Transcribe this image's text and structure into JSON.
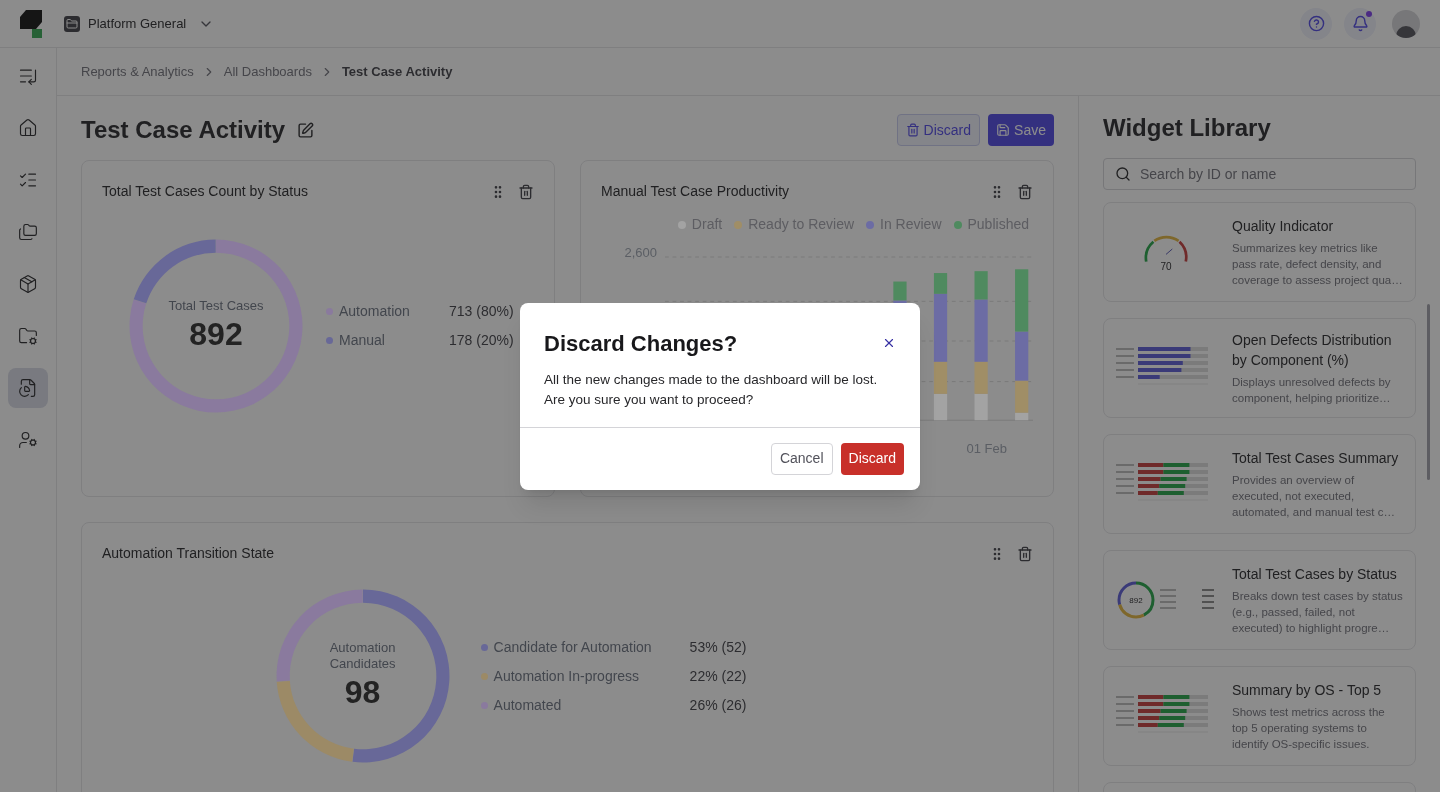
{
  "topbar": {
    "workspace": "Platform General",
    "notification_dot": true
  },
  "breadcrumbs": [
    {
      "label": "Reports & Analytics",
      "current": false
    },
    {
      "label": "All Dashboards",
      "current": false
    },
    {
      "label": "Test Case Activity",
      "current": true
    }
  ],
  "sidebar": {
    "items": [
      {
        "kind": "collapse",
        "selected": false
      },
      {
        "kind": "home",
        "selected": false
      },
      {
        "kind": "checklist",
        "selected": false
      },
      {
        "kind": "folders",
        "selected": false
      },
      {
        "kind": "packages",
        "selected": false
      },
      {
        "kind": "folder-gear",
        "selected": false
      },
      {
        "kind": "report",
        "selected": true
      },
      {
        "kind": "user-gear",
        "selected": false
      }
    ]
  },
  "page": {
    "title": "Test Case Activity",
    "buttons": [
      {
        "label": "Discard",
        "kind": "secondary"
      },
      {
        "label": "Save",
        "kind": "primary"
      }
    ]
  },
  "widgets": [
    {
      "kind": "donut",
      "title": "Total Test Cases Count by Status",
      "center_label": "Total Test Cases",
      "center_value": "892",
      "legend": [
        {
          "value": "713 (80%)",
          "color": "#8a7a9e"
        },
        {
          "value": "178 (20%)",
          "color": "#686898"
        }
      ],
      "chart_data": {
        "type": "donut",
        "categories": [
          "Automation",
          "Manual"
        ],
        "values": [
          80,
          20
        ]
      }
    },
    {
      "kind": "bars",
      "title": "Manual Test Case Productivity",
      "legend": [
        {
          "label": "Draft",
          "color": "#a3a3a3"
        },
        {
          "label": "Ready to Review",
          "color": "#a08e66"
        },
        {
          "label": "In Review",
          "color": "#6c6ca4"
        },
        {
          "label": "Published",
          "color": "#4f8a5f"
        }
      ],
      "ytick": "2,600",
      "xtick": "01 Feb"
    },
    {
      "kind": "donut",
      "title": "Automation Transition State",
      "center_label": "Automation Candidates",
      "center_value": "98",
      "legend": [
        {
          "value": "53% (52)",
          "color": "#686898"
        },
        {
          "value": "22% (22)",
          "color": "#9c8a66"
        },
        {
          "value": "26% (26)",
          "color": "#8a7a9e"
        }
      ],
      "chart_data": {
        "type": "donut",
        "categories": [
          "Candidate for Automation",
          "Automation In-progress",
          "Automated"
        ],
        "values": [
          52,
          22,
          26
        ]
      }
    }
  ],
  "library": {
    "title": "Widget Library",
    "search": {
      "placeholder": "Search by ID or name"
    },
    "items": [
      {
        "kind": "gauge",
        "title": "Quality Indicator",
        "description": "Summarizes key metrics like pass rate, defect density, and coverage to assess project qua…",
        "thumb_value": "70"
      },
      {
        "kind": "hbars-blue",
        "title": "Open Defects Distribution by Component (%)",
        "description": "Displays unresolved defects by component, helping prioritize…"
      },
      {
        "kind": "hbars-redgreen",
        "title": "Total Test Cases Summary",
        "description": "Provides an overview of executed, not executed, automated, and manual test c…"
      },
      {
        "kind": "donut",
        "title": "Total Test Cases by Status",
        "description": "Breaks down test cases by status (e.g., passed, failed, not executed) to highlight progre…",
        "thumb_value": "892"
      },
      {
        "kind": "hbars-redgreen",
        "title": "Summary by OS - Top 5",
        "description": "Shows test metrics across the top 5 operating systems to identify OS-specific issues."
      },
      {
        "kind": "empty"
      }
    ]
  },
  "dialog": {
    "title": "Discard Changes?",
    "message": "All the new changes made to the dashboard will be lost. Are you sure you want to proceed?",
    "buttons": [
      {
        "label": "Cancel",
        "kind": "secondary"
      },
      {
        "label": "Discard",
        "kind": "danger"
      }
    ]
  }
}
